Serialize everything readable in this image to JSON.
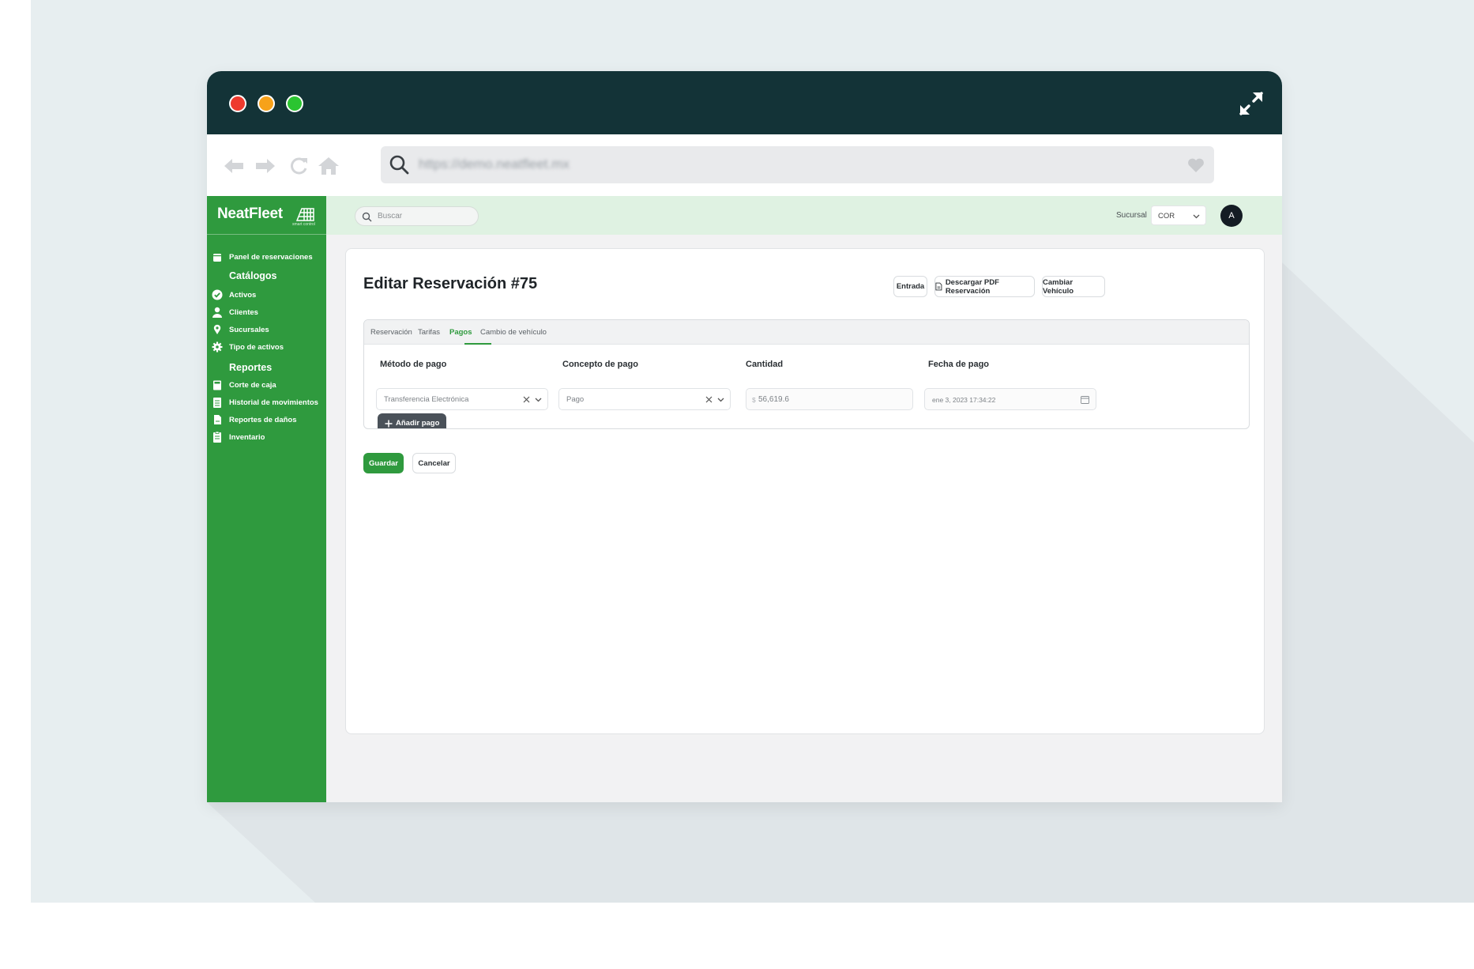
{
  "browser": {
    "url": "https://demo.neatfleet.mx"
  },
  "brand": {
    "name": "NeatFleet",
    "tagline": "smart control",
    "accent": "#2f9a3e",
    "titlebar": "#133337"
  },
  "sidebar": {
    "items": [
      {
        "label": "Panel de reservaciones",
        "icon": "calendar-icon"
      },
      {
        "label": "Activos",
        "icon": "check-circle-icon"
      },
      {
        "label": "Clientes",
        "icon": "user-icon"
      },
      {
        "label": "Sucursales",
        "icon": "map-pin-icon"
      },
      {
        "label": "Tipo de activos",
        "icon": "gear-icon"
      },
      {
        "label": "Corte de caja",
        "icon": "cash-register-icon"
      },
      {
        "label": "Historial de movimientos",
        "icon": "clipboard-list-icon"
      },
      {
        "label": "Reportes de daños",
        "icon": "file-icon"
      },
      {
        "label": "Inventario",
        "icon": "clipboard-check-icon"
      }
    ],
    "headings": {
      "catalogs": "Catálogos",
      "reports": "Reportes"
    }
  },
  "topbar": {
    "search_placeholder": "Buscar",
    "branch_label": "Sucursal",
    "branch_value": "COR",
    "avatar_initial": "A"
  },
  "page": {
    "title": "Editar Reservación #75",
    "actions": {
      "entry": "Entrada",
      "download_pdf": "Descargar PDF Reservación",
      "change_vehicle": "Cambiar Vehículo"
    },
    "tabs": [
      "Reservación",
      "Tarifas",
      "Pagos",
      "Cambio de vehículo"
    ],
    "active_tab": "Pagos",
    "payments": {
      "columns": [
        "Método de pago",
        "Concepto de pago",
        "Cantidad",
        "Fecha de pago"
      ],
      "row": {
        "method": "Transferencia Electrónica",
        "concept": "Pago",
        "currency": "$",
        "amount": "56,619.6",
        "date": "ene 3, 2023 17:34:22"
      },
      "add_label": "Añadir pago"
    },
    "save_label": "Guardar",
    "cancel_label": "Cancelar"
  }
}
